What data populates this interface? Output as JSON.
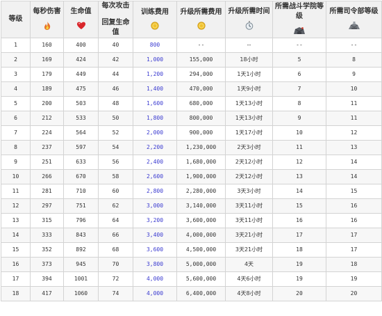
{
  "headers": {
    "level": "等级",
    "dps": "每秒伤害",
    "hp": "生命值",
    "per_attack": "每次攻击",
    "regen": "回复生命值",
    "train_cost": "训练费用",
    "upgrade_cost": "升级所需费用",
    "upgrade_time": "升级所需时间",
    "academy_level": "所需战斗学院等级",
    "hq_level": "所需司令部等级"
  },
  "icons": {
    "dps": "flame-icon",
    "hp": "heart-icon",
    "train_cost": "gold-coin-icon",
    "upgrade_cost": "gold-coin-icon",
    "upgrade_time": "stopwatch-icon",
    "academy_level": "barracks-icon",
    "hq_level": "headquarters-icon"
  },
  "rows": [
    {
      "level": "1",
      "dps": "160",
      "hp": "400",
      "attack": "40",
      "train_cost": "800",
      "upgrade_cost": "--",
      "time": "--",
      "academy": "--",
      "hq": "--"
    },
    {
      "level": "2",
      "dps": "169",
      "hp": "424",
      "attack": "42",
      "train_cost": "1,000",
      "upgrade_cost": "155,000",
      "time": "18小时",
      "academy": "5",
      "hq": "8"
    },
    {
      "level": "3",
      "dps": "179",
      "hp": "449",
      "attack": "44",
      "train_cost": "1,200",
      "upgrade_cost": "294,000",
      "time": "1天1小时",
      "academy": "6",
      "hq": "9"
    },
    {
      "level": "4",
      "dps": "189",
      "hp": "475",
      "attack": "46",
      "train_cost": "1,400",
      "upgrade_cost": "470,000",
      "time": "1天9小时",
      "academy": "7",
      "hq": "10"
    },
    {
      "level": "5",
      "dps": "200",
      "hp": "503",
      "attack": "48",
      "train_cost": "1,600",
      "upgrade_cost": "680,000",
      "time": "1天13小时",
      "academy": "8",
      "hq": "11"
    },
    {
      "level": "6",
      "dps": "212",
      "hp": "533",
      "attack": "50",
      "train_cost": "1,800",
      "upgrade_cost": "800,000",
      "time": "1天13小时",
      "academy": "9",
      "hq": "11"
    },
    {
      "level": "7",
      "dps": "224",
      "hp": "564",
      "attack": "52",
      "train_cost": "2,000",
      "upgrade_cost": "900,000",
      "time": "1天17小时",
      "academy": "10",
      "hq": "12"
    },
    {
      "level": "8",
      "dps": "237",
      "hp": "597",
      "attack": "54",
      "train_cost": "2,200",
      "upgrade_cost": "1,230,000",
      "time": "2天3小时",
      "academy": "11",
      "hq": "13"
    },
    {
      "level": "9",
      "dps": "251",
      "hp": "633",
      "attack": "56",
      "train_cost": "2,400",
      "upgrade_cost": "1,680,000",
      "time": "2天12小时",
      "academy": "12",
      "hq": "14"
    },
    {
      "level": "10",
      "dps": "266",
      "hp": "670",
      "attack": "58",
      "train_cost": "2,600",
      "upgrade_cost": "1,900,000",
      "time": "2天12小时",
      "academy": "13",
      "hq": "14"
    },
    {
      "level": "11",
      "dps": "281",
      "hp": "710",
      "attack": "60",
      "train_cost": "2,800",
      "upgrade_cost": "2,280,000",
      "time": "3天3小时",
      "academy": "14",
      "hq": "15"
    },
    {
      "level": "12",
      "dps": "297",
      "hp": "751",
      "attack": "62",
      "train_cost": "3,000",
      "upgrade_cost": "3,140,000",
      "time": "3天11小时",
      "academy": "15",
      "hq": "16"
    },
    {
      "level": "13",
      "dps": "315",
      "hp": "796",
      "attack": "64",
      "train_cost": "3,200",
      "upgrade_cost": "3,600,000",
      "time": "3天11小时",
      "academy": "16",
      "hq": "16"
    },
    {
      "level": "14",
      "dps": "333",
      "hp": "843",
      "attack": "66",
      "train_cost": "3,400",
      "upgrade_cost": "4,000,000",
      "time": "3天21小时",
      "academy": "17",
      "hq": "17"
    },
    {
      "level": "15",
      "dps": "352",
      "hp": "892",
      "attack": "68",
      "train_cost": "3,600",
      "upgrade_cost": "4,500,000",
      "time": "3天21小时",
      "academy": "18",
      "hq": "17"
    },
    {
      "level": "16",
      "dps": "373",
      "hp": "945",
      "attack": "70",
      "train_cost": "3,800",
      "upgrade_cost": "5,000,000",
      "time": "4天",
      "academy": "19",
      "hq": "18"
    },
    {
      "level": "17",
      "dps": "394",
      "hp": "1001",
      "attack": "72",
      "train_cost": "4,000",
      "upgrade_cost": "5,600,000",
      "time": "4天6小时",
      "academy": "19",
      "hq": "19"
    },
    {
      "level": "18",
      "dps": "417",
      "hp": "1060",
      "attack": "74",
      "train_cost": "4,000",
      "upgrade_cost": "6,400,000",
      "time": "4天8小时",
      "academy": "20",
      "hq": "20"
    }
  ]
}
